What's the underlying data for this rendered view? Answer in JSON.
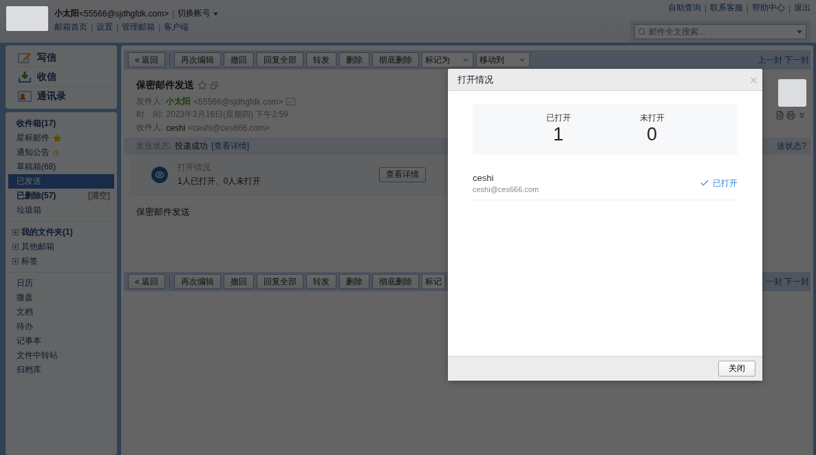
{
  "header": {
    "user_name": "小太阳",
    "user_email": "<55566@sjdhgfdk.com>",
    "account_separator": "|",
    "switch_account": "切换帐号",
    "links": [
      {
        "label": "邮箱首页"
      },
      {
        "separator": "|",
        "label": "设置"
      },
      {
        "separator": "|",
        "label": "管理邮箱"
      },
      {
        "separator": "|",
        "label": "客户端"
      }
    ],
    "top_links": [
      {
        "label": "自助查询"
      },
      {
        "separator": "|",
        "label": "联系客服"
      },
      {
        "separator": "|",
        "label": "帮助中心"
      },
      {
        "separator": "|",
        "label": "退出"
      }
    ],
    "search": {
      "placeholder": "邮件全文搜索..."
    }
  },
  "quick_actions": [
    {
      "label": "写信",
      "kind": "compose"
    },
    {
      "label": "收信",
      "kind": "receive"
    },
    {
      "label": "通讯录",
      "kind": "contacts"
    }
  ],
  "folders": [
    {
      "label": "收件箱(17)",
      "bold": true,
      "selected": false,
      "kind": "plain"
    },
    {
      "label": "星标邮件",
      "bold": false,
      "selected": false,
      "kind": "star"
    },
    {
      "label": "通知公告",
      "bold": false,
      "selected": false,
      "kind": "speaker"
    },
    {
      "label": "草稿箱(68)",
      "bold": false,
      "selected": false,
      "kind": "plain"
    },
    {
      "label": "已发送",
      "bold": false,
      "selected": true,
      "kind": "plain"
    },
    {
      "label": "已删除(57)",
      "bold": true,
      "selected": false,
      "kind": "plain",
      "action": "[清空]"
    },
    {
      "label": "垃圾箱",
      "bold": false,
      "selected": false,
      "kind": "plain"
    }
  ],
  "folder_groups": [
    {
      "label": "我的文件夹(1)",
      "bold": true,
      "expanded": false
    },
    {
      "label": "其他邮箱",
      "bold": false,
      "expanded": false
    },
    {
      "label": "标签",
      "bold": false,
      "expanded": false
    }
  ],
  "apps": [
    "日历",
    "微盘",
    "文档",
    "待办",
    "记事本",
    "文件中转站",
    "归档库"
  ],
  "toolbar_top": {
    "buttons": [
      "« 返回",
      "再次编辑",
      "撤回",
      "回复全部",
      "转发",
      "删除",
      "彻底删除"
    ],
    "selects": [
      "标记为",
      "移动到"
    ],
    "nav": [
      "上一封",
      "下一封"
    ]
  },
  "message": {
    "subject": "保密邮件发送",
    "starred": false,
    "from_label": "发件人:",
    "from_name": "小太阳",
    "from_email": "<55566@sjdhgfdk.com>",
    "time_label": "时　间:",
    "time": "2023年3月16日(星期四) 下午2:59",
    "to_label": "收件人:",
    "to_name": "ceshi",
    "to_email": "<ceshi@ces666.com>",
    "delivery": {
      "label": "发送状态:",
      "value": "投递成功",
      "link": "[查看详情]",
      "help_link": "送状态?"
    },
    "open_card": {
      "title": "打开情况",
      "summary": "1人已打开、0人未打开",
      "button": "查看详情"
    },
    "body": "保密邮件发送"
  },
  "toolbar_bottom": {
    "buttons": [
      "« 返回",
      "再次编辑",
      "撤回",
      "回复全部",
      "转发",
      "删除",
      "彻底删除"
    ],
    "selects": [
      "标记"
    ],
    "nav": [
      "一封",
      "下一封"
    ]
  },
  "dialog": {
    "title": "打开情况",
    "stats": [
      {
        "label": "已打开",
        "value": "1"
      },
      {
        "label": "未打开",
        "value": "0"
      }
    ],
    "recipients": [
      {
        "name": "ceshi",
        "email": "ceshi@ces666.com",
        "status": "已打开",
        "opened": true
      }
    ],
    "close_button": "关闭"
  }
}
